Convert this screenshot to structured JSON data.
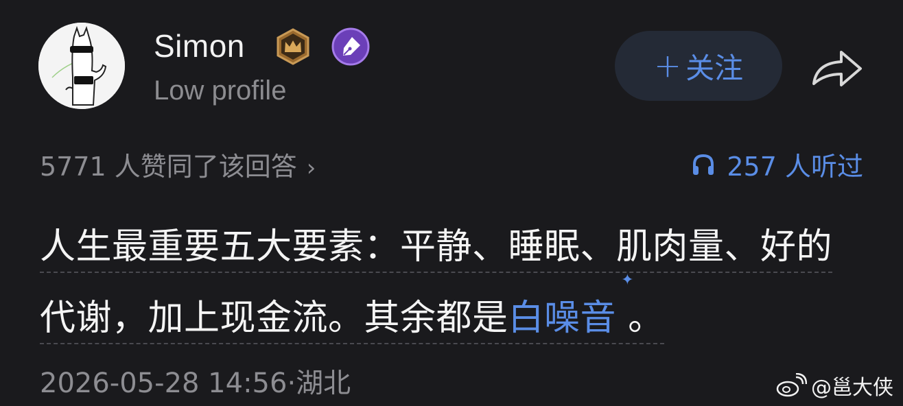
{
  "author": {
    "name": "Simon",
    "bio": "Low profile",
    "avatar_icon": "cartoon-alpaca-sunglasses-icon",
    "badges": [
      "crown-badge-icon",
      "pen-badge-icon"
    ]
  },
  "actions": {
    "follow_plus": "+",
    "follow_label": "关注",
    "share_icon": "share-arrow-icon"
  },
  "stats": {
    "likes_text": "5771 人赞同了该回答",
    "likes_chevron": "›",
    "listen_icon": "headphones-icon",
    "listens_text": "257 人听过"
  },
  "answer": {
    "text_part1": "人生最重要五大要素：平静、睡眠、肌肉量、好的代谢，加上现金流。其余都是",
    "link_text": "白噪音",
    "link_sparkle": "✦",
    "text_end": "。"
  },
  "meta": {
    "datetime_location": "2026-05-28 14:56·湖北"
  },
  "watermark": {
    "text": "@邕大侠",
    "icon": "weibo-icon"
  },
  "colors": {
    "background": "#1a1a1d",
    "accent": "#5a8de6",
    "muted": "#8d8d92"
  }
}
